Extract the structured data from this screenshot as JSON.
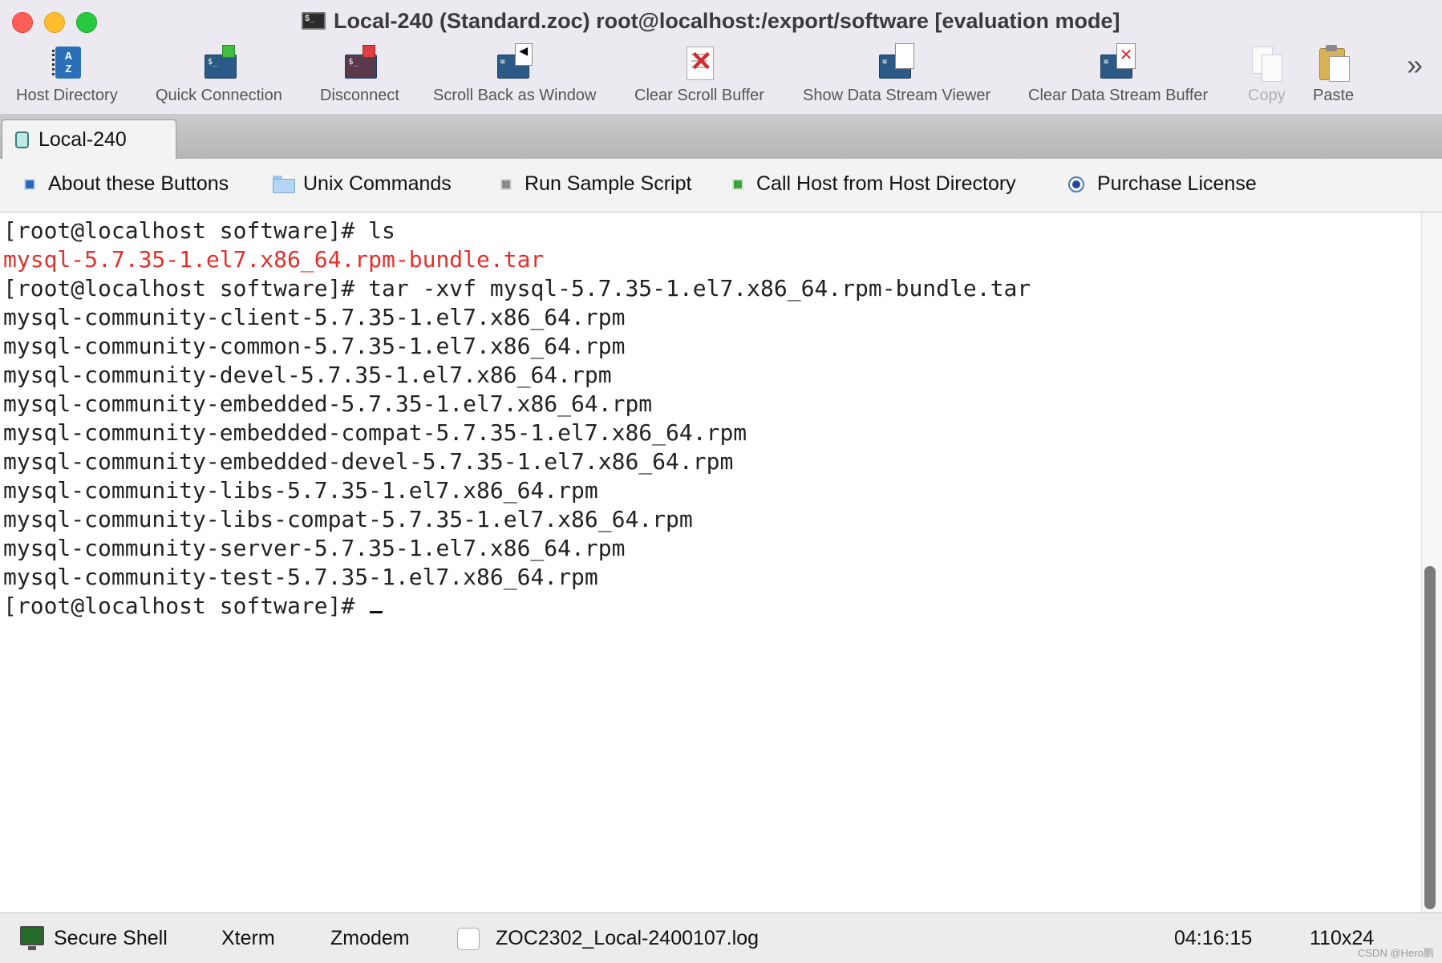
{
  "window": {
    "title": "Local-240 (Standard.zoc) root@localhost:/export/software [evaluation mode]"
  },
  "toolbar": {
    "items": [
      {
        "label": "Host Directory",
        "icon": "address-book-icon"
      },
      {
        "label": "Quick Connection",
        "icon": "quick-connect-icon"
      },
      {
        "label": "Disconnect",
        "icon": "disconnect-icon"
      },
      {
        "label": "Scroll Back as Window",
        "icon": "scrollback-window-icon"
      },
      {
        "label": "Clear Scroll Buffer",
        "icon": "clear-buffer-icon"
      },
      {
        "label": "Show Data Stream Viewer",
        "icon": "data-stream-viewer-icon"
      },
      {
        "label": "Clear Data Stream Buffer",
        "icon": "clear-data-stream-icon"
      },
      {
        "label": "Copy",
        "icon": "copy-icon",
        "disabled": true
      },
      {
        "label": "Paste",
        "icon": "paste-icon"
      }
    ],
    "more_icon": "chevron-double-right-icon"
  },
  "tabs": [
    {
      "label": "Local-240",
      "active": true
    }
  ],
  "user_buttons": [
    {
      "label": "About these Buttons",
      "icon": "blue-square-icon"
    },
    {
      "label": "Unix Commands",
      "icon": "folder-icon"
    },
    {
      "label": "Run Sample Script",
      "icon": "gray-square-icon"
    },
    {
      "label": "Call Host from Host Directory",
      "icon": "green-square-icon"
    },
    {
      "label": "Purchase License",
      "icon": "radio-dot-icon"
    }
  ],
  "terminal": {
    "lines": [
      {
        "text": "[root@localhost software]# ls",
        "color": "#222222"
      },
      {
        "text": "mysql-5.7.35-1.el7.x86_64.rpm-bundle.tar",
        "color": "#e0312c"
      },
      {
        "text": "[root@localhost software]# tar -xvf mysql-5.7.35-1.el7.x86_64.rpm-bundle.tar",
        "color": "#222222"
      },
      {
        "text": "mysql-community-client-5.7.35-1.el7.x86_64.rpm",
        "color": "#222222"
      },
      {
        "text": "mysql-community-common-5.7.35-1.el7.x86_64.rpm",
        "color": "#222222"
      },
      {
        "text": "mysql-community-devel-5.7.35-1.el7.x86_64.rpm",
        "color": "#222222"
      },
      {
        "text": "mysql-community-embedded-5.7.35-1.el7.x86_64.rpm",
        "color": "#222222"
      },
      {
        "text": "mysql-community-embedded-compat-5.7.35-1.el7.x86_64.rpm",
        "color": "#222222"
      },
      {
        "text": "mysql-community-embedded-devel-5.7.35-1.el7.x86_64.rpm",
        "color": "#222222"
      },
      {
        "text": "mysql-community-libs-5.7.35-1.el7.x86_64.rpm",
        "color": "#222222"
      },
      {
        "text": "mysql-community-libs-compat-5.7.35-1.el7.x86_64.rpm",
        "color": "#222222"
      },
      {
        "text": "mysql-community-server-5.7.35-1.el7.x86_64.rpm",
        "color": "#222222"
      },
      {
        "text": "mysql-community-test-5.7.35-1.el7.x86_64.rpm",
        "color": "#222222"
      }
    ],
    "prompt": "[root@localhost software]# "
  },
  "statusbar": {
    "secure_shell": "Secure Shell",
    "xterm": "Xterm",
    "zmodem": "Zmodem",
    "log_file": "ZOC2302_Local-2400107.log",
    "time": "04:16:15",
    "size": "110x24"
  },
  "watermark": "CSDN @Hero鹏"
}
